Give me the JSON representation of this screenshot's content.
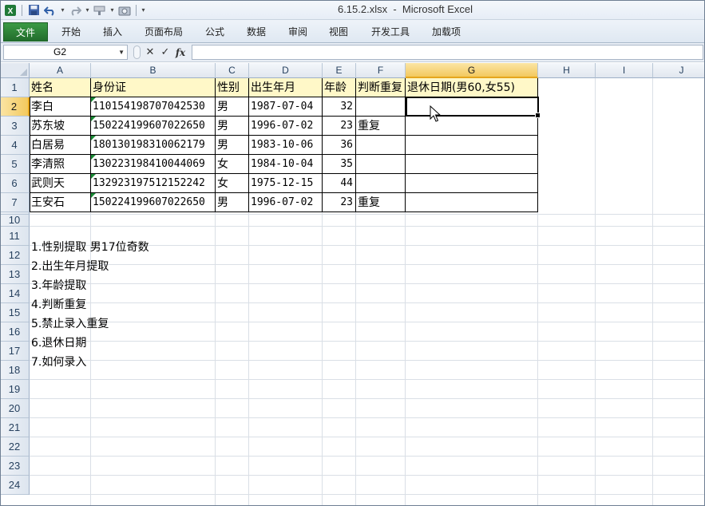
{
  "window": {
    "title": "6.15.2.xlsx  -  Microsoft Excel"
  },
  "quick_access": {
    "icons": [
      "excel-logo-icon",
      "save-icon",
      "undo-icon",
      "redo-icon",
      "format-painter-icon",
      "camera-icon",
      "customize-icon"
    ]
  },
  "ribbon": {
    "tabs": [
      "文件",
      "开始",
      "插入",
      "页面布局",
      "公式",
      "数据",
      "审阅",
      "视图",
      "开发工具",
      "加载项"
    ]
  },
  "formula_bar": {
    "name_box": "G2",
    "content": ""
  },
  "sheet": {
    "selected_cell": "G2",
    "columns": [
      "A",
      "B",
      "C",
      "D",
      "E",
      "F",
      "G",
      "H",
      "I",
      "J"
    ],
    "rows": [
      "1",
      "2",
      "3",
      "4",
      "5",
      "6",
      "7",
      "10",
      "11",
      "12",
      "13",
      "14",
      "15",
      "16",
      "17",
      "18",
      "19",
      "20",
      "21",
      "22",
      "23",
      "24"
    ],
    "header_row": [
      "姓名",
      "身份证",
      "性别",
      "出生年月",
      "年龄",
      "判断重复",
      "退休日期(男60,女55)"
    ],
    "data_rows": [
      [
        "李白",
        "110154198707042530",
        "男",
        "1987-07-04",
        "32",
        "",
        ""
      ],
      [
        "苏东坡",
        "150224199607022650",
        "男",
        "1996-07-02",
        "23",
        "重复",
        ""
      ],
      [
        "白居易",
        "180130198310062179",
        "男",
        "1983-10-06",
        "36",
        "",
        ""
      ],
      [
        "李清照",
        "130223198410044069",
        "女",
        "1984-10-04",
        "35",
        "",
        ""
      ],
      [
        "武则天",
        "132923197512152242",
        "女",
        "1975-12-15",
        "44",
        "",
        ""
      ],
      [
        "王安石",
        "150224199607022650",
        "男",
        "1996-07-02",
        "23",
        "重复",
        ""
      ]
    ],
    "notes": [
      "1.性别提取 男17位奇数",
      "2.出生年月提取",
      "3.年龄提取",
      "4.判断重复",
      "5.禁止录入重复",
      "6.退休日期",
      "7.如何录入"
    ]
  }
}
